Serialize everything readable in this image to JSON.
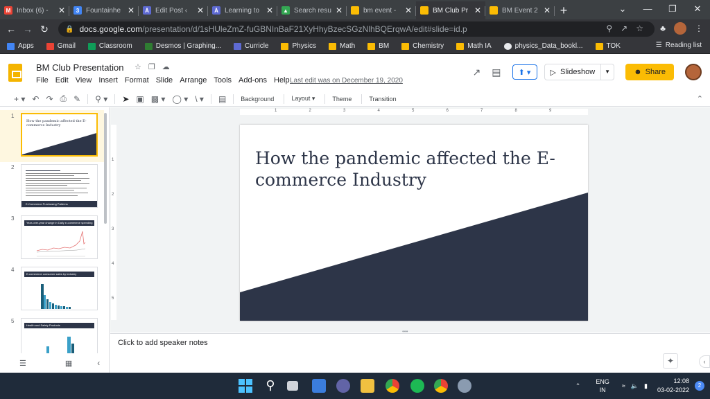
{
  "browser": {
    "tabs": [
      {
        "title": "Inbox (6) - ",
        "icon": "gmail-icon",
        "color": "#ea4335",
        "glyph": "M"
      },
      {
        "title": "Fountainhe",
        "icon": "sites-icon",
        "color": "#4285f4",
        "glyph": "3"
      },
      {
        "title": "Edit Post ‹",
        "icon": "blogger-icon",
        "color": "#5e6ad2",
        "glyph": "Ȧ"
      },
      {
        "title": "Learning to",
        "icon": "blogger-icon",
        "color": "#5e6ad2",
        "glyph": "Ȧ"
      },
      {
        "title": "Search resu",
        "icon": "drive-icon",
        "color": "#34a853",
        "glyph": "▲"
      },
      {
        "title": "bm event -",
        "icon": "slides-icon",
        "color": "#fbbc04",
        "glyph": ""
      },
      {
        "title": "BM Club Pr",
        "icon": "slides-icon",
        "color": "#fbbc04",
        "glyph": ""
      },
      {
        "title": "BM Event 2",
        "icon": "slides-icon",
        "color": "#fbbc04",
        "glyph": ""
      }
    ],
    "active_tab_index": 6,
    "new_tab": "+",
    "url_host": "docs.google.com",
    "url_path": "/presentation/d/1sHUleZmZ-fuGBNInBaF21XyHhyBzecSGzNlhBQErqwA/edit#slide=id.p",
    "bookmarks": [
      {
        "label": "Apps",
        "icon": "apps-icon"
      },
      {
        "label": "Gmail",
        "icon": "gmail-icon"
      },
      {
        "label": "Classroom",
        "icon": "classroom-icon"
      },
      {
        "label": "Desmos | Graphing...",
        "icon": "desmos-icon"
      },
      {
        "label": "Curricle",
        "icon": "blogger-icon"
      },
      {
        "label": "Physics",
        "icon": "folder-icon"
      },
      {
        "label": "Math",
        "icon": "folder-icon"
      },
      {
        "label": "BM",
        "icon": "folder-icon"
      },
      {
        "label": "Chemistry",
        "icon": "folder-icon"
      },
      {
        "label": "Math IA",
        "icon": "folder-icon"
      },
      {
        "label": "physics_Data_bookl...",
        "icon": "github-icon"
      },
      {
        "label": "TOK",
        "icon": "folder-icon"
      }
    ],
    "reading_list": "Reading list"
  },
  "doc": {
    "title": "BM Club Presentation",
    "menus": [
      "File",
      "Edit",
      "View",
      "Insert",
      "Format",
      "Slide",
      "Arrange",
      "Tools",
      "Add-ons",
      "Help"
    ],
    "last_edit": "Last edit was on December 19, 2020",
    "slideshow": "Slideshow",
    "share": "Share"
  },
  "toolbar": {
    "background": "Background",
    "layout": "Layout ▾",
    "theme": "Theme",
    "transition": "Transition"
  },
  "filmstrip": {
    "slides": [
      {
        "num": "1",
        "title": "How the pandemic affected the E-commerce Industry"
      },
      {
        "num": "2",
        "caption": "E-Commerce Purchasing Patterns"
      },
      {
        "num": "3",
        "title": "Year-over-year change in Daily e-commerce spending"
      },
      {
        "num": "4",
        "title": "E-commerce consumer sales by industry"
      },
      {
        "num": "5",
        "title": "Health and Safety Products"
      }
    ]
  },
  "ruler": {
    "h": [
      "1",
      "2",
      "3",
      "4",
      "5",
      "6",
      "7",
      "8",
      "9"
    ],
    "v": [
      "1",
      "2",
      "3",
      "4",
      "5"
    ]
  },
  "slide": {
    "title": "How the pandemic affected the E-commerce Industry",
    "band_color": "#2d3548"
  },
  "notes": {
    "placeholder": "Click to add speaker notes"
  },
  "taskbar": {
    "lang_top": "ENG",
    "lang_bottom": "IN",
    "time": "12:08",
    "date": "03-02-2022",
    "notifications": "2"
  }
}
